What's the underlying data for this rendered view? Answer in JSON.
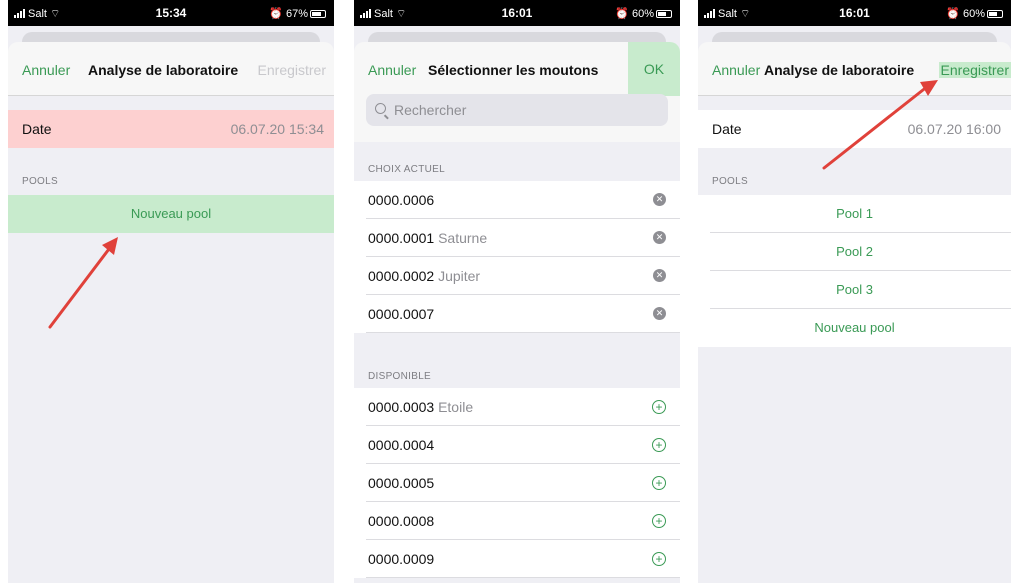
{
  "screen1": {
    "status": {
      "carrier": "Salt",
      "time": "15:34",
      "battery": "67%"
    },
    "nav": {
      "left": "Annuler",
      "title": "Analyse de laboratoire",
      "right": "Enregistrer"
    },
    "date_row": {
      "label": "Date",
      "value": "06.07.20 15:34"
    },
    "pools_header": "POOLS",
    "new_pool": "Nouveau pool"
  },
  "screen2": {
    "status": {
      "carrier": "Salt",
      "time": "16:01",
      "battery": "60%"
    },
    "nav": {
      "left": "Annuler",
      "title": "Sélectionner les moutons",
      "right": "OK"
    },
    "search_placeholder": "Rechercher",
    "current_header": "CHOIX ACTUEL",
    "current": [
      {
        "id": "0000.0006",
        "name": ""
      },
      {
        "id": "0000.0001",
        "name": "Saturne"
      },
      {
        "id": "0000.0002",
        "name": "Jupiter"
      },
      {
        "id": "0000.0007",
        "name": ""
      }
    ],
    "available_header": "DISPONIBLE",
    "available": [
      {
        "id": "0000.0003",
        "name": "Etoile"
      },
      {
        "id": "0000.0004",
        "name": ""
      },
      {
        "id": "0000.0005",
        "name": ""
      },
      {
        "id": "0000.0008",
        "name": ""
      },
      {
        "id": "0000.0009",
        "name": ""
      }
    ]
  },
  "screen3": {
    "status": {
      "carrier": "Salt",
      "time": "16:01",
      "battery": "60%"
    },
    "nav": {
      "left": "Annuler",
      "title": "Analyse de laboratoire",
      "right": "Enregistrer"
    },
    "date_row": {
      "label": "Date",
      "value": "06.07.20 16:00"
    },
    "pools_header": "POOLS",
    "pools": [
      "Pool 1",
      "Pool 2",
      "Pool 3"
    ],
    "new_pool": "Nouveau pool"
  },
  "colors": {
    "accent": "#3a9a55",
    "highlight": "#c8ebcd",
    "error": "#fdd0d0",
    "arrow": "#e0413a"
  }
}
